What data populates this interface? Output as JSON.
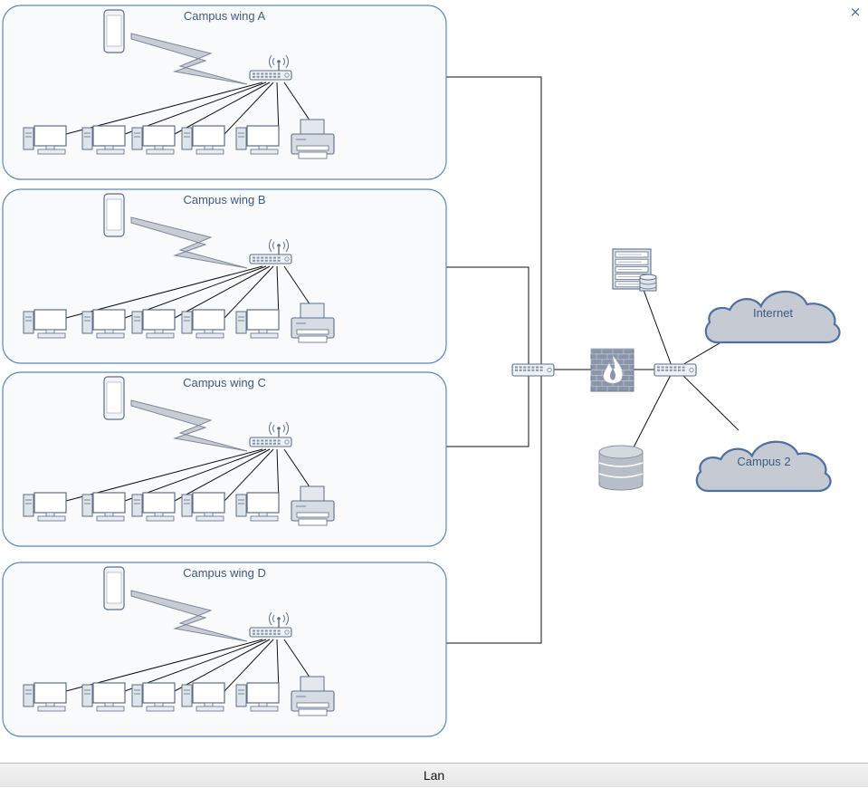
{
  "window": {
    "close_symbol": "×"
  },
  "footer": {
    "title": "Lan"
  },
  "wings": [
    {
      "label": "Campus wing A"
    },
    {
      "label": "Campus wing B"
    },
    {
      "label": "Campus wing C"
    },
    {
      "label": "Campus wing D"
    }
  ],
  "clouds": {
    "internet": "Internet",
    "campus2": "Campus 2"
  },
  "colors": {
    "box_border": "#5d87b8",
    "box_fill": "#f9fafc",
    "device_stroke": "#5e6f86",
    "device_fill": "#e9edf3",
    "firewall": "#8a95a8",
    "cloud_fill": "#c6cbd3",
    "cloud_stroke": "#4f70a3",
    "label_text": "#3d5a80",
    "wire": "#111111"
  },
  "icons": {
    "phone": "mobile-phone-icon",
    "wireless": "lightning-bolt-icon",
    "access_point": "wireless-access-point-icon",
    "computer": "desktop-computer-icon",
    "printer": "printer-icon",
    "switch": "network-switch-icon",
    "firewall": "firewall-icon",
    "server": "server-rack-icon",
    "database": "database-icon",
    "cloud": "cloud-icon"
  }
}
